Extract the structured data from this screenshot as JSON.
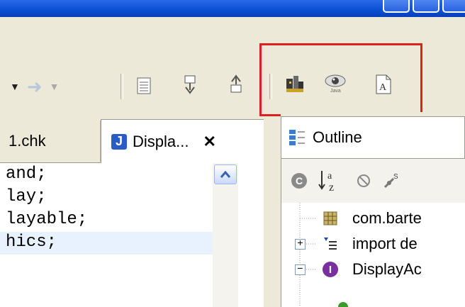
{
  "editor": {
    "tabs": [
      {
        "label": "1.chk"
      },
      {
        "label": "Displa...",
        "close": "✕"
      }
    ],
    "code_lines": [
      "and;",
      "lay;",
      "layable;",
      "hics;"
    ]
  },
  "outline": {
    "title": "Outline",
    "tree": [
      {
        "label": "com.barte",
        "icon": "package-icon"
      },
      {
        "label": "import de",
        "icon": "imports-icon"
      },
      {
        "label": "DisplayAc",
        "icon": "interface-icon"
      }
    ]
  },
  "colors": {
    "highlight_border": "#e02020",
    "interface_icon": "#7a2fa0",
    "active_tab_icon": "#2a5cc8"
  }
}
